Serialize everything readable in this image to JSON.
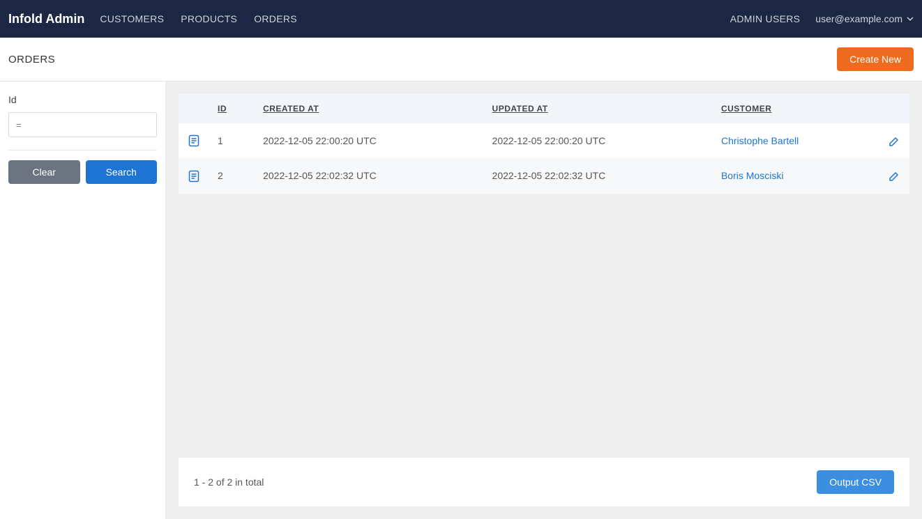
{
  "nav": {
    "brand": "Infold Admin",
    "links": [
      "CUSTOMERS",
      "PRODUCTS",
      "ORDERS"
    ],
    "admin_users": "ADMIN USERS",
    "user_email": "user@example.com"
  },
  "page": {
    "title": "ORDERS",
    "create_new": "Create New"
  },
  "filter": {
    "id_label": "Id",
    "id_placeholder": "=",
    "clear": "Clear",
    "search": "Search"
  },
  "table": {
    "headers": {
      "id": "ID",
      "created_at": "CREATED AT",
      "updated_at": "UPDATED AT",
      "customer": "CUSTOMER"
    },
    "rows": [
      {
        "id": "1",
        "created_at": "2022-12-05 22:00:20 UTC",
        "updated_at": "2022-12-05 22:00:20 UTC",
        "customer": "Christophe Bartell"
      },
      {
        "id": "2",
        "created_at": "2022-12-05 22:02:32 UTC",
        "updated_at": "2022-12-05 22:02:32 UTC",
        "customer": "Boris Mosciski"
      }
    ]
  },
  "footer": {
    "range": "1 - 2 of 2 in total",
    "output_csv": "Output CSV"
  }
}
